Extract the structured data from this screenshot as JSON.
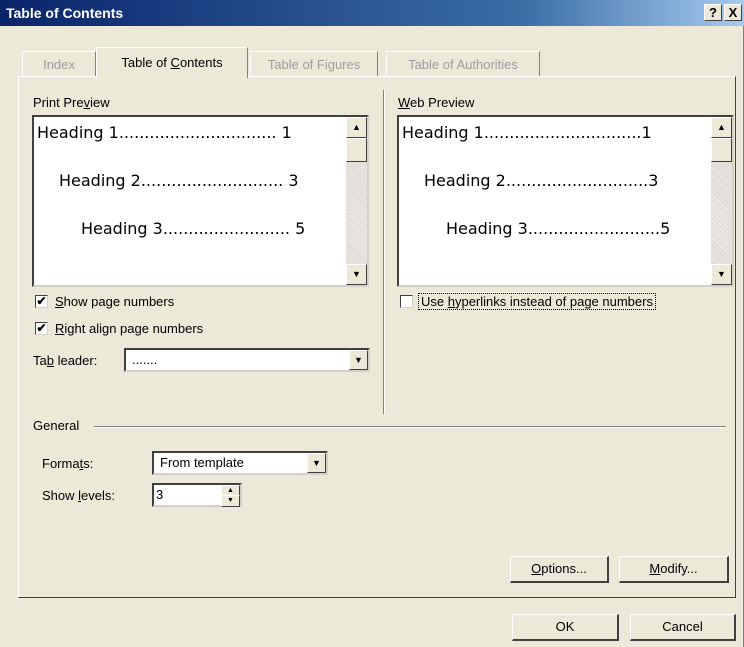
{
  "dialog": {
    "title": "Table of Contents",
    "help_label": "?",
    "close_label": "X"
  },
  "tabs": {
    "index": "Index",
    "toc": {
      "pre": "Table of ",
      "u": "C",
      "post": "ontents"
    },
    "figures": "Table of Figures",
    "authorities": "Table of Authorities"
  },
  "print_preview": {
    "label": {
      "pre": "Print Pre",
      "u": "v",
      "post": "iew"
    },
    "rows": [
      {
        "text": "Heading 1...............................",
        "page": "1"
      },
      {
        "text": "Heading 2............................",
        "page": "3"
      },
      {
        "text": "Heading 3.........................",
        "page": "5"
      }
    ]
  },
  "web_preview": {
    "label": {
      "pre": "",
      "u": "W",
      "post": "eb Preview"
    },
    "rows": [
      {
        "text": "Heading 1...............................",
        "page": "1"
      },
      {
        "text": "Heading 2............................",
        "page": "3"
      },
      {
        "text": "Heading 3..........................",
        "page": "5"
      }
    ]
  },
  "options": {
    "show_page_numbers": {
      "pre": "",
      "u": "S",
      "post": "how page numbers",
      "checked": true
    },
    "right_align": {
      "pre": "",
      "u": "R",
      "post": "ight align page numbers",
      "checked": true
    },
    "use_hyperlinks": {
      "pre": "Use ",
      "u": "h",
      "post": "yperlinks instead of page numbers",
      "checked": false
    },
    "tab_leader": {
      "label": {
        "pre": "Ta",
        "u": "b",
        "post": " leader:"
      },
      "value": "......."
    }
  },
  "general": {
    "title": "General",
    "formats": {
      "label": {
        "pre": "Forma",
        "u": "t",
        "post": "s:"
      },
      "value": "From template"
    },
    "show_levels": {
      "label": {
        "pre": "Show ",
        "u": "l",
        "post": "evels:"
      },
      "value": "3"
    }
  },
  "buttons": {
    "options": {
      "pre": "",
      "u": "O",
      "post": "ptions..."
    },
    "modify": {
      "pre": "",
      "u": "M",
      "post": "odify..."
    },
    "ok": "OK",
    "cancel": "Cancel"
  },
  "check_mark": "✔",
  "arrow_up": "▲",
  "arrow_down": "▼"
}
